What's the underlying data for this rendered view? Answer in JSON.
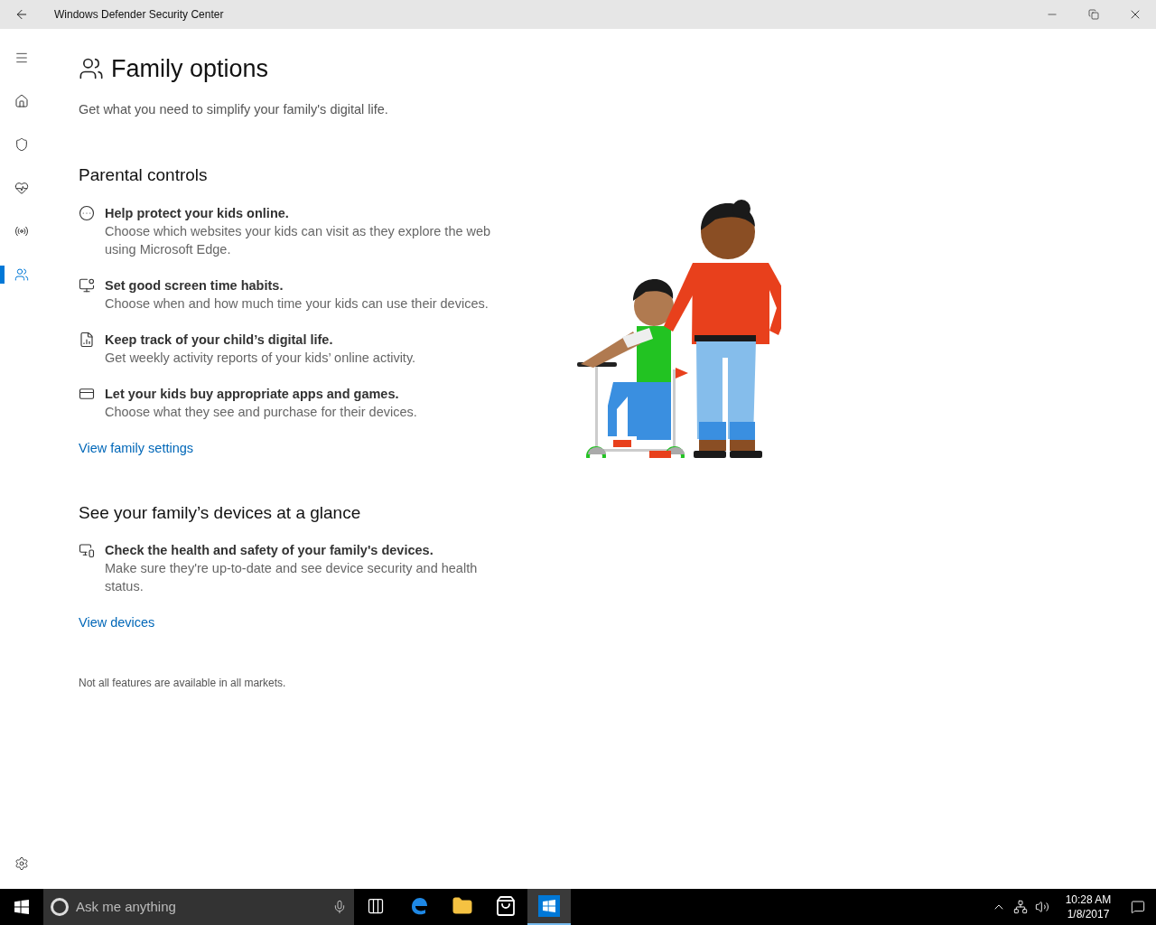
{
  "window": {
    "title": "Windows Defender Security Center"
  },
  "sidebar": {
    "items": [
      {
        "kind": "home",
        "selected": false
      },
      {
        "kind": "shield",
        "selected": false
      },
      {
        "kind": "health",
        "selected": false
      },
      {
        "kind": "network",
        "selected": false
      },
      {
        "kind": "family",
        "selected": true
      }
    ]
  },
  "page": {
    "title": "Family options",
    "subtitle": "Get what you need to simplify your family's digital life.",
    "sections": [
      {
        "heading": "Parental controls",
        "items": [
          {
            "kind": "web",
            "title": "Help protect your kids online.",
            "description": "Choose which websites your kids can visit as they explore the web using Microsoft Edge."
          },
          {
            "kind": "screen-time",
            "title": "Set good screen time habits.",
            "description": "Choose when and how much time your kids can use their devices."
          },
          {
            "kind": "report",
            "title": "Keep track of your child’s digital life.",
            "description": "Get weekly activity reports of your kids’ online activity."
          },
          {
            "kind": "purchase",
            "title": "Let your kids buy appropriate apps and games.",
            "description": "Choose what they see and purchase for their devices."
          }
        ],
        "link": "View family settings"
      },
      {
        "heading": "See your family’s devices at a glance",
        "items": [
          {
            "kind": "devices",
            "title": "Check the health and safety of your family's devices.",
            "description": "Make sure they're up-to-date and see device security and health status."
          }
        ],
        "link": "View devices"
      }
    ],
    "footnote": "Not all features are available in all markets."
  },
  "taskbar": {
    "search_placeholder": "Ask me anything",
    "apps": [
      {
        "kind": "task-view",
        "selected": false
      },
      {
        "kind": "edge",
        "selected": false
      },
      {
        "kind": "explorer",
        "selected": false
      },
      {
        "kind": "store",
        "selected": false
      },
      {
        "kind": "defender",
        "selected": true
      }
    ],
    "time": "10:28 AM",
    "date": "1/8/2017"
  }
}
